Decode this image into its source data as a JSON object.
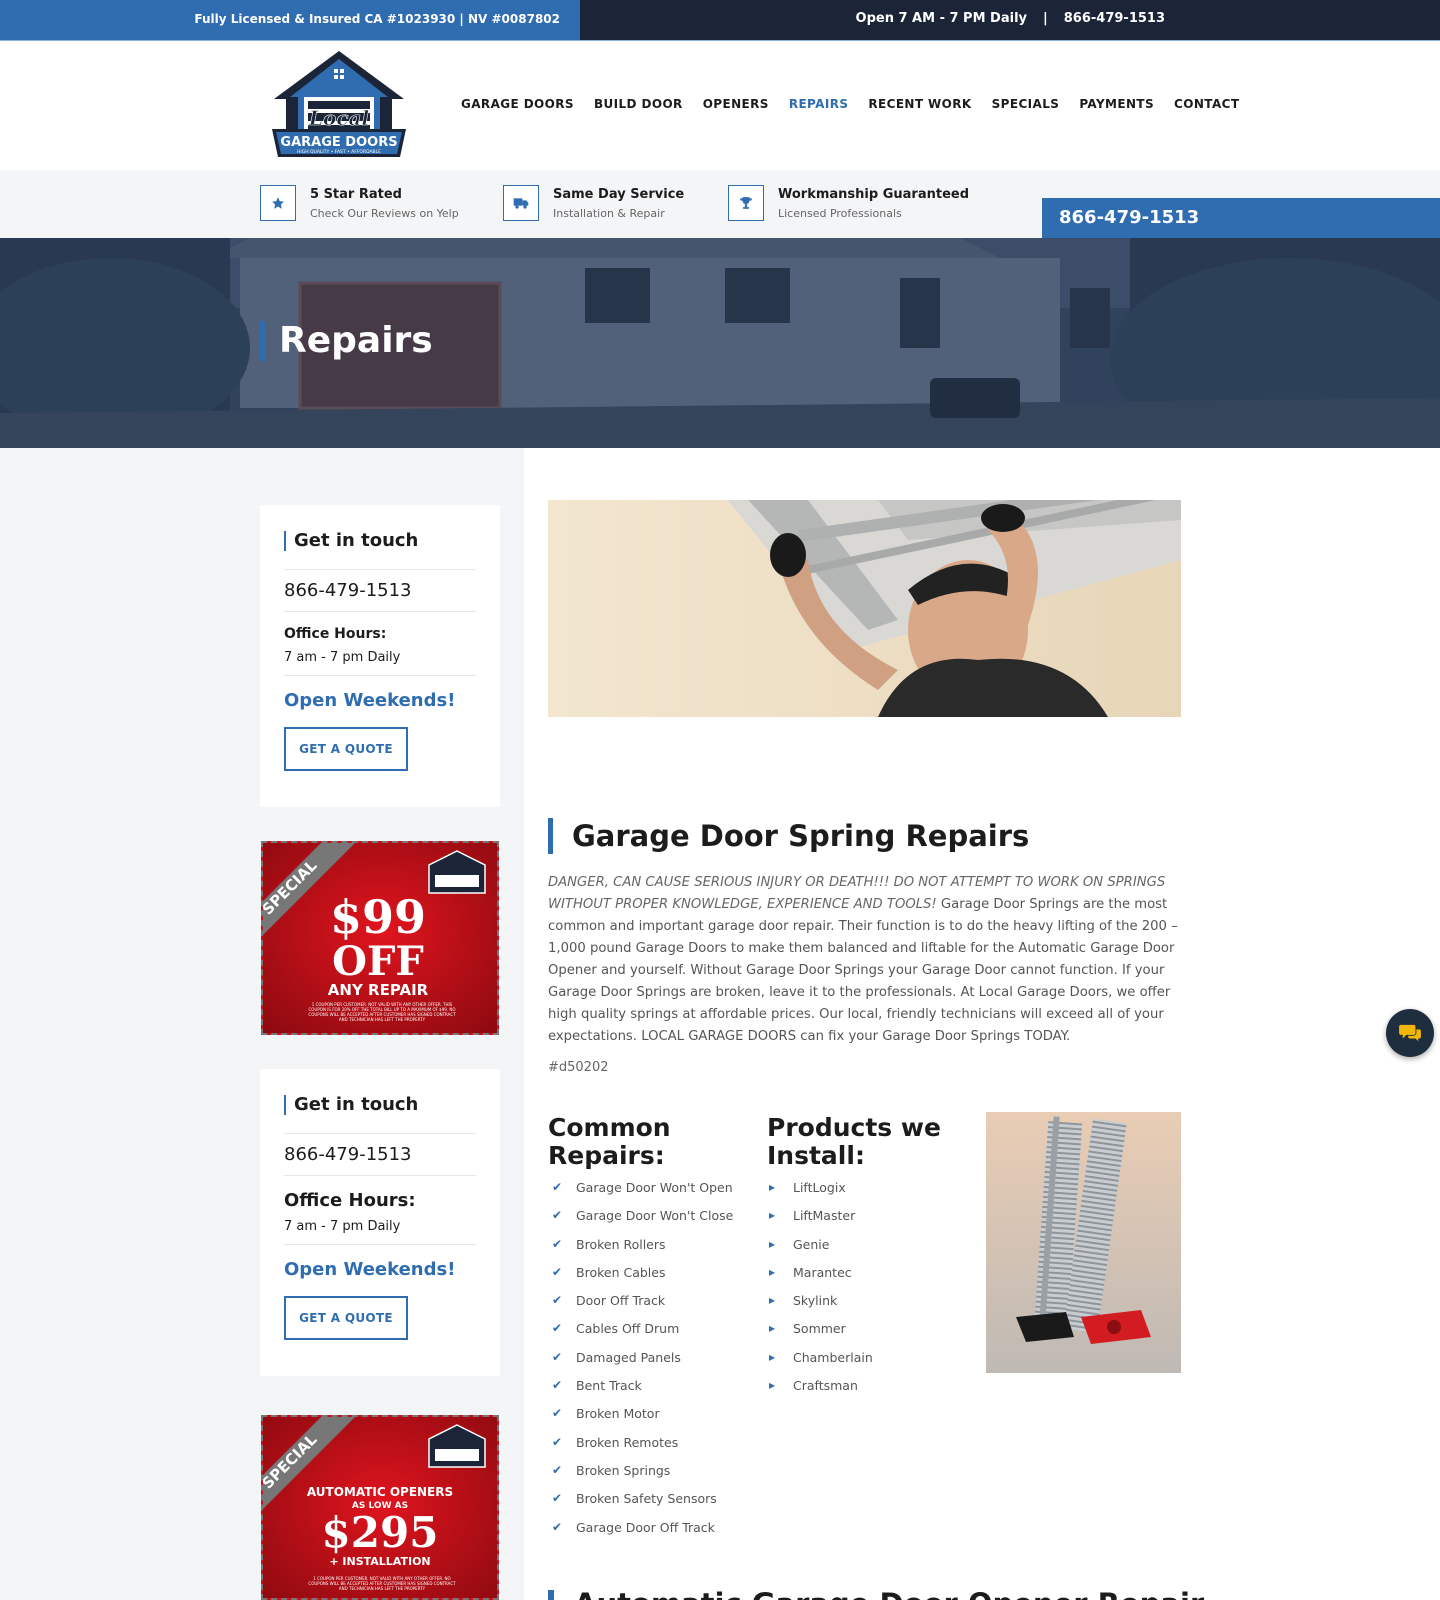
{
  "topbar": {
    "license": "Fully Licensed & Insured CA #1023930 | NV #0087802",
    "hours": "Open 7 AM - 7 PM Daily",
    "separator": "|",
    "phone": "866-479-1513"
  },
  "logo": {
    "word1": "Local",
    "word2": "GARAGE DOORS",
    "tagline": "HIGH QUALITY • FAST • AFFORDABLE"
  },
  "nav": [
    {
      "label": "GARAGE DOORS",
      "active": false
    },
    {
      "label": "BUILD DOOR",
      "active": false
    },
    {
      "label": "OPENERS",
      "active": false
    },
    {
      "label": "REPAIRS",
      "active": true
    },
    {
      "label": "RECENT WORK",
      "active": false
    },
    {
      "label": "SPECIALS",
      "active": false
    },
    {
      "label": "PAYMENTS",
      "active": false
    },
    {
      "label": "CONTACT",
      "active": false
    }
  ],
  "features": [
    {
      "icon": "star-icon",
      "title": "5 Star Rated",
      "sub": "Check Our Reviews on Yelp"
    },
    {
      "icon": "truck-icon",
      "title": "Same Day Service",
      "sub": "Installation & Repair"
    },
    {
      "icon": "trophy-icon",
      "title": "Workmanship Guaranteed",
      "sub": "Licensed Professionals"
    }
  ],
  "phone_box": "866-479-1513",
  "hero": {
    "title": "Repairs"
  },
  "sidebar": {
    "card1": {
      "title": "Get in touch",
      "phone": "866-479-1513",
      "hours_label": "Office Hours:",
      "hours": "7 am - 7 pm Daily",
      "open": "Open Weekends!",
      "button": "GET A QUOTE"
    },
    "coupon1": {
      "ribbon": "SPECIAL",
      "line1": "$99",
      "line2": "OFF",
      "line3": "ANY REPAIR",
      "fine1": "1 COUPON PER CUSTOMER. NOT VALID WITH ANY OTHER OFFER. THIS",
      "fine2": "COUPON IS FOR 20% OFF THE TOTAL BILL UP TO A MAXIMUM OF $99. NO",
      "fine3": "COUPONS WILL BE ACCEPTED AFTER CUSTOMER HAS SIGNED CONTRACT",
      "fine4": "AND TECHNICIAN HAS LEFT THE PROPERTY"
    },
    "card2": {
      "title": "Get in touch",
      "phone": "866-479-1513",
      "hours_label": "Office Hours:",
      "hours": "7 am - 7 pm Daily",
      "open": "Open Weekends!",
      "button": "GET A QUOTE"
    },
    "coupon2": {
      "ribbon": "SPECIAL",
      "line1": "AUTOMATIC OPENERS",
      "line2": "AS LOW AS",
      "line3": "$295",
      "line4": "+ INSTALLATION",
      "fine1": "1 COUPON PER CUSTOMER. NOT VALID WITH ANY OTHER OFFER. NO",
      "fine2": "COUPONS WILL BE ACCEPTED AFTER CUSTOMER HAS SIGNED CONTRACT",
      "fine3": "AND TECHNICIAN HAS LEFT THE PROPERTY"
    }
  },
  "main": {
    "section_title": "Garage Door Spring Repairs",
    "warning": "DANGER, CAN CAUSE SERIOUS INJURY OR DEATH!!! DO NOT ATTEMPT TO WORK ON SPRINGS WITHOUT PROPER KNOWLEDGE, EXPERIENCE AND TOOLS!",
    "body": " Garage Door Springs are the most common and important garage door repair. Their function is to do the heavy lifting of the 200 – 1,000 pound Garage Doors to make them balanced and liftable for the Automatic Garage Door Opener and yourself. Without Garage Door Springs your Garage Door cannot function. If your Garage Door Springs are broken, leave it to the professionals. At Local Garage Doors, we offer high quality springs at affordable prices. Our local, friendly technicians will exceed all of your expectations. LOCAL GARAGE DOORS can fix your Garage Door Springs TODAY.",
    "hashtag": "#d50202",
    "repairs_heading": "Common Repairs:",
    "repairs": [
      "Garage Door Won't Open",
      "Garage Door Won't Close",
      "Broken Rollers",
      "Broken Cables",
      "Door Off Track",
      "Cables Off Drum",
      "Damaged Panels",
      "Bent Track",
      "Broken Motor",
      "Broken Remotes",
      "Broken Springs",
      "Broken Safety Sensors",
      "Garage Door Off Track"
    ],
    "products_heading": "Products we Install:",
    "products": [
      "LiftLogix",
      "LiftMaster",
      "Genie",
      "Marantec",
      "Skylink",
      "Sommer",
      "Chamberlain",
      "Craftsman"
    ],
    "next_title": "Automatic Garage Door Opener Repair"
  },
  "colors": {
    "accent": "#2f6db0",
    "topbar": "#1b2537",
    "coupon_red": "#c8101a"
  }
}
